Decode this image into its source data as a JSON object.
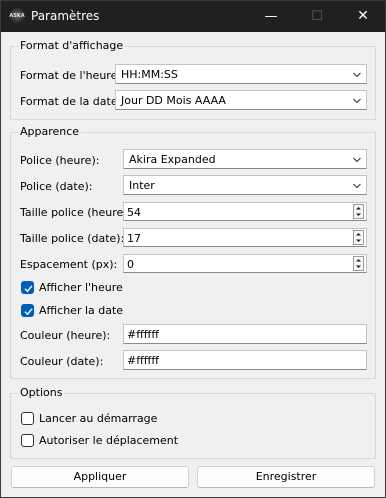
{
  "window": {
    "title": "Paramètres",
    "app_icon_text": "ASKA",
    "minimize_glyph": "—",
    "maximize_glyph": "☐",
    "close_glyph": "✕"
  },
  "format_group": {
    "title": "Format d'affichage",
    "time_format_label": "Format de l'heure:",
    "time_format_value": "HH:MM:SS",
    "date_format_label": "Format de la date:",
    "date_format_value": "Jour DD Mois AAAA"
  },
  "appearance_group": {
    "title": "Apparence",
    "time_font_label": "Police (heure):",
    "time_font_value": "Akira Expanded",
    "date_font_label": "Police (date):",
    "date_font_value": "Inter",
    "time_size_label": "Taille police (heure):",
    "time_size_value": "54",
    "date_size_label": "Taille police (date):",
    "date_size_value": "17",
    "spacing_label": "Espacement (px):",
    "spacing_value": "0",
    "show_time_label": "Afficher l'heure",
    "show_time_checked": true,
    "show_date_label": "Afficher la date",
    "show_date_checked": true,
    "time_color_label": "Couleur (heure):",
    "time_color_value": "#ffffff",
    "date_color_label": "Couleur (date):",
    "date_color_value": "#ffffff"
  },
  "options_group": {
    "title": "Options",
    "startup_label": "Lancer au démarrage",
    "startup_checked": false,
    "move_label": "Autoriser le déplacement",
    "move_checked": false
  },
  "buttons": {
    "apply_label": "Appliquer",
    "save_label": "Enregistrer"
  },
  "colors": {
    "accent": "#005fb8",
    "titlebar": "#202020",
    "window_bg": "#f0f0f0"
  }
}
